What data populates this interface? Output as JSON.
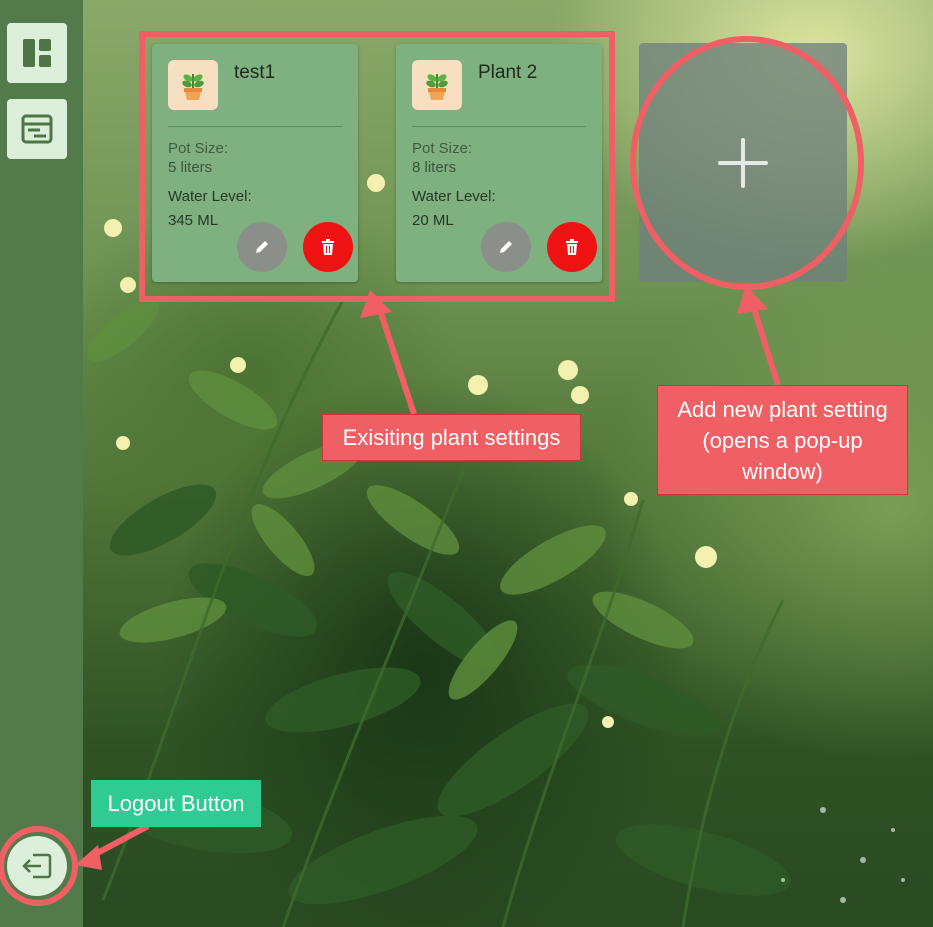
{
  "sidebar": {
    "items": [
      {
        "icon": "dashboard-icon"
      },
      {
        "icon": "schedule-icon"
      }
    ],
    "logout": {
      "icon": "logout-icon"
    }
  },
  "plants": [
    {
      "name": "test1",
      "pot_size_label": "Pot Size:",
      "pot_size": "5 liters",
      "water_level_label": "Water Level:",
      "water_level": "345 ML",
      "icon": "potted-plant-icon"
    },
    {
      "name": "Plant 2",
      "pot_size_label": "Pot Size:",
      "pot_size": "8 liters",
      "water_level_label": "Water Level:",
      "water_level": "20 ML",
      "icon": "potted-plant-icon"
    }
  ],
  "add_card": {
    "icon": "plus-icon"
  },
  "annotations": {
    "existing": "Exisiting plant settings",
    "add_line1": "Add new plant setting",
    "add_line2": "(opens a pop-up",
    "add_line3": "window)",
    "logout": "Logout Button"
  },
  "colors": {
    "sidebar": "#537a4a",
    "card": "#7fb07f",
    "delete": "#ee1212",
    "edit": "#8a8f8a",
    "annotation_red": "#ef5f64",
    "annotation_green": "#2fcb93"
  }
}
